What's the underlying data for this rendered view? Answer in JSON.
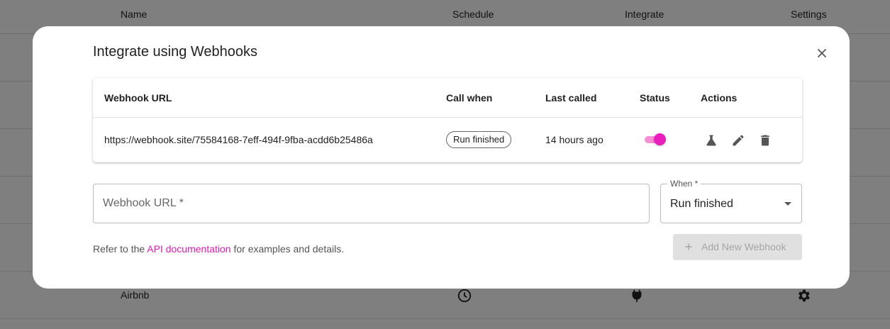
{
  "background": {
    "headers": {
      "name": "Name",
      "schedule": "Schedule",
      "integrate": "Integrate",
      "settings": "Settings"
    },
    "visible_row": {
      "name": "Airbnb",
      "schedule_icon": "clock-icon",
      "integrate_icon": "plug-icon",
      "settings_icon": "gear-icon"
    }
  },
  "modal": {
    "title": "Integrate using Webhooks",
    "close_icon": "close-icon",
    "table": {
      "columns": {
        "url": "Webhook URL",
        "call_when": "Call when",
        "last_called": "Last called",
        "status": "Status",
        "actions": "Actions"
      },
      "rows": [
        {
          "url": "https://webhook.site/75584168-7eff-494f-9fba-acdd6b25486a",
          "call_when": "Run finished",
          "last_called": "14 hours ago",
          "status_enabled": true,
          "actions": [
            "flask-icon",
            "pencil-icon",
            "trash-icon"
          ]
        }
      ]
    },
    "form": {
      "url_placeholder": "Webhook URL *",
      "url_value": "",
      "when_label": "When *",
      "when_value": "Run finished",
      "refer_prefix": "Refer to the ",
      "refer_link": "API documentation",
      "refer_suffix": " for examples and details.",
      "add_button": "Add New Webhook",
      "add_button_disabled": true
    }
  },
  "colors": {
    "accent": "#e91ebd",
    "accent_light": "#f48fd6",
    "overlay": "rgba(0,0,0,0.5)"
  }
}
